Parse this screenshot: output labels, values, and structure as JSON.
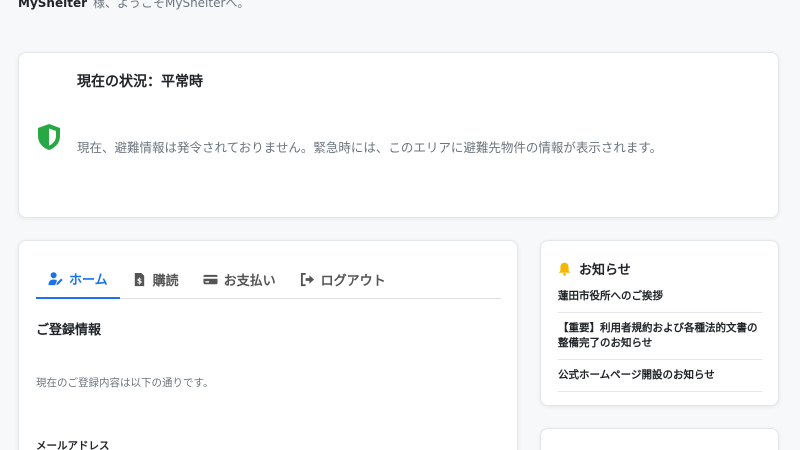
{
  "header": {
    "username": "MyShelter",
    "welcome_text": "様、ようこそMyShelterへ。"
  },
  "status": {
    "title": "現在の状況：平常時",
    "message": "現在、避難情報は発令されておりません。緊急時には、このエリアに避難先物件の情報が表示されます。",
    "icon": "shield-check-icon",
    "icon_color": "#28a745"
  },
  "tabs": [
    {
      "label": "ホーム",
      "icon": "user-edit-icon",
      "active": true
    },
    {
      "label": "購読",
      "icon": "file-invoice-icon",
      "active": false
    },
    {
      "label": "お支払い",
      "icon": "credit-card-icon",
      "active": false
    },
    {
      "label": "ログアウト",
      "icon": "sign-out-icon",
      "active": false
    }
  ],
  "registration": {
    "title": "ご登録情報",
    "description": "現在のご登録内容は以下の通りです。",
    "email_label": "メールアドレス"
  },
  "notices": {
    "title": "お知らせ",
    "icon": "bell-icon",
    "icon_color": "#f5b800",
    "items": [
      "蓮田市役所へのご挨拶",
      "【重要】利用者規約および各種法的文書の整備完了のお知らせ",
      "公式ホームページ開設のお知らせ"
    ]
  },
  "colors": {
    "accent": "#1a73e8",
    "background": "#f7f8fa"
  }
}
